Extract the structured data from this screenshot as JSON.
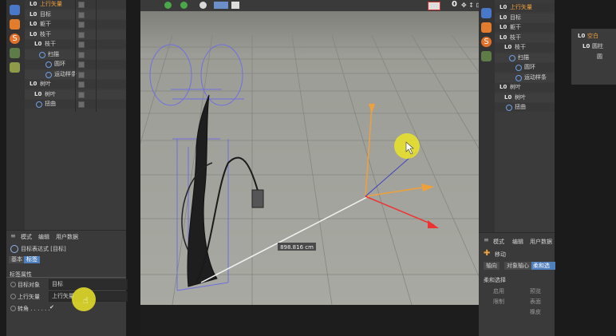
{
  "left_panel": {
    "tree": [
      {
        "prefix": "L0",
        "label": "上行矢量",
        "highlight": true
      },
      {
        "prefix": "L0",
        "label": "目标",
        "highlight": false
      },
      {
        "prefix": "L0",
        "label": "躯干",
        "highlight": false
      },
      {
        "prefix": "L0",
        "label": "枝干",
        "highlight": false
      },
      {
        "prefix": "L0",
        "label": "枝干",
        "highlight": false
      },
      {
        "prefix": "",
        "label": "扫描",
        "highlight": false
      },
      {
        "prefix": "",
        "label": "圆环",
        "highlight": false
      },
      {
        "prefix": "",
        "label": "运动样条",
        "highlight": false
      },
      {
        "prefix": "L0",
        "label": "树叶",
        "highlight": false
      },
      {
        "prefix": "L0",
        "label": "树叶",
        "highlight": false
      },
      {
        "prefix": "",
        "label": "扭曲",
        "highlight": false
      }
    ]
  },
  "attributes": {
    "menu": [
      "模式",
      "编辑",
      "用户数据"
    ],
    "title": "目标表达式 [目标]",
    "tabs": [
      "基本",
      "标签"
    ],
    "section": "标签属性",
    "fields": [
      {
        "label": "目标对象",
        "value": "目标"
      },
      {
        "label": "上行矢量",
        "value": "上行矢量"
      },
      {
        "label": "转角 . . . . . .",
        "value": "✔"
      }
    ]
  },
  "viewport": {
    "toolbar_value": "0",
    "measure_label": "898.816 cm"
  },
  "right_panel": {
    "tree": [
      {
        "prefix": "L0",
        "label": "上行矢量",
        "highlight": true
      },
      {
        "prefix": "L0",
        "label": "目标",
        "highlight": false
      },
      {
        "prefix": "L0",
        "label": "躯干",
        "highlight": false
      },
      {
        "prefix": "L0",
        "label": "枝干",
        "highlight": false
      },
      {
        "prefix": "L0",
        "label": "枝干",
        "highlight": false
      },
      {
        "prefix": "",
        "label": "扫描",
        "highlight": false
      },
      {
        "prefix": "",
        "label": "圆环",
        "highlight": false
      },
      {
        "prefix": "",
        "label": "运动样条",
        "highlight": false
      },
      {
        "prefix": "L0",
        "label": "树叶",
        "highlight": false
      },
      {
        "prefix": "L0",
        "label": "树叶",
        "highlight": false
      },
      {
        "prefix": "",
        "label": "扭曲",
        "highlight": false
      }
    ],
    "menu": [
      "模式",
      "编辑",
      "用户数据"
    ],
    "tool_title": "移动",
    "tabs": [
      "轴向",
      "对象轴心",
      "柔和选择"
    ],
    "section": "柔和选择",
    "options": [
      "启用",
      "预览",
      "限制",
      "表面",
      "橡皮"
    ]
  },
  "far_right": {
    "items": [
      {
        "prefix": "L0",
        "label": "空白"
      },
      {
        "prefix": "L0",
        "label": "圆柱"
      },
      {
        "prefix": "",
        "label": "圆"
      },
      {
        "prefix": "",
        "label": ""
      }
    ]
  },
  "colors": {
    "panel_bg": "#3a3a3a",
    "viewport_bg": "#9a9b93",
    "accent_orange": "#f2a33a",
    "highlight_yellow": "#d9d33a"
  }
}
